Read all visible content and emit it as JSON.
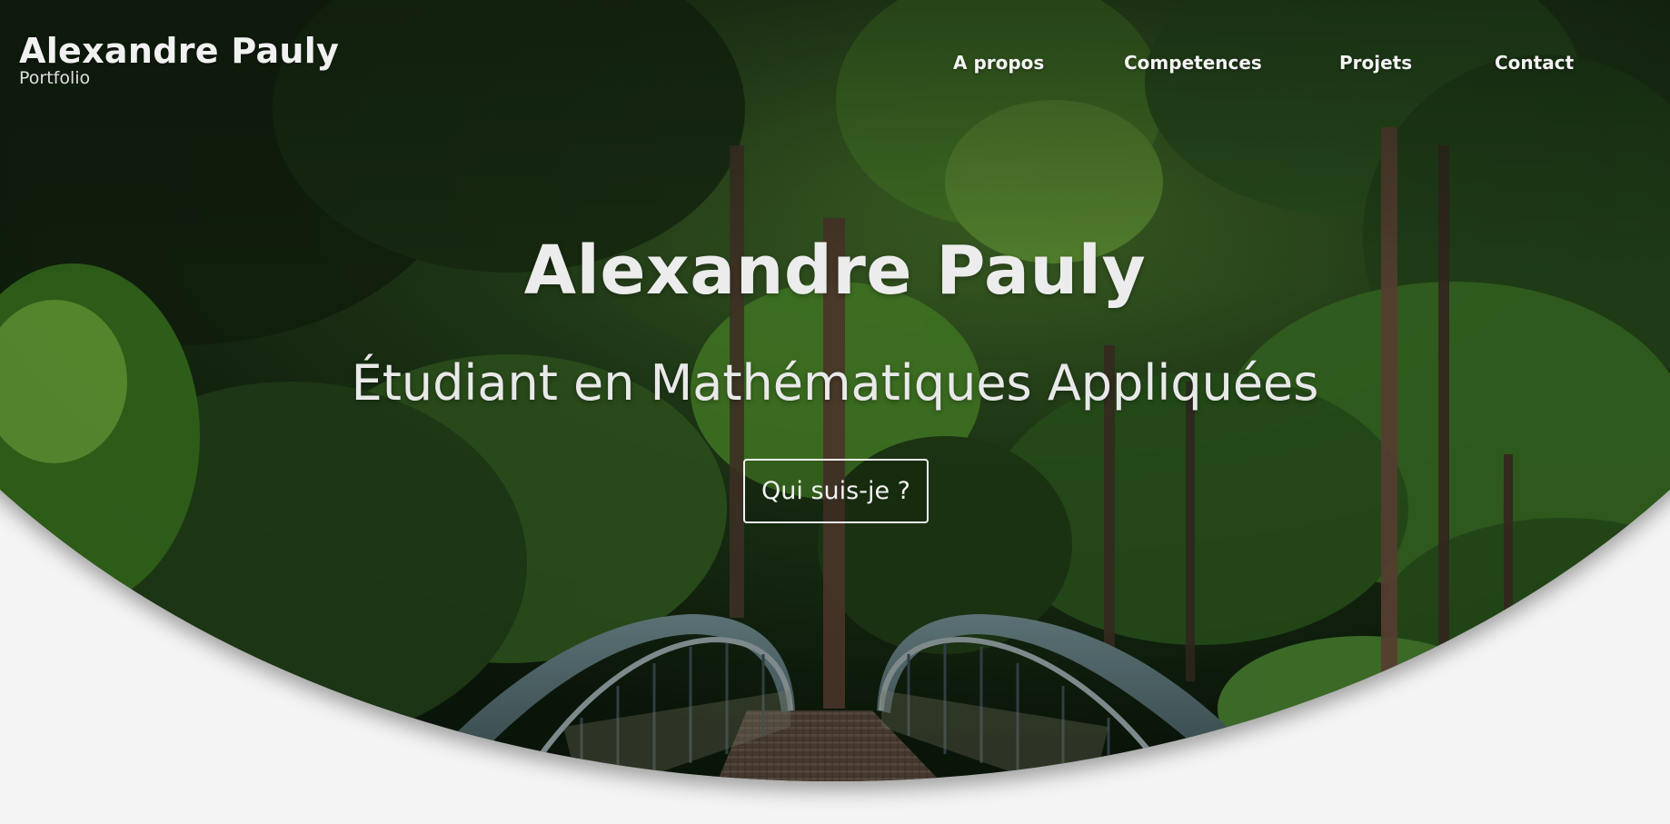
{
  "header": {
    "brand_name": "Alexandre Pauly",
    "brand_subtitle": "Portfolio"
  },
  "nav": {
    "items": [
      {
        "label": "A propos"
      },
      {
        "label": "Competences"
      },
      {
        "label": "Projets"
      },
      {
        "label": "Contact"
      }
    ]
  },
  "hero": {
    "title": "Alexandre Pauly",
    "subtitle": "Étudiant en Mathématiques Appliquées",
    "cta_label": "Qui suis-je ?",
    "background_description_icon": "forest-bridge-image"
  },
  "colors": {
    "page_background": "#f4f4f4",
    "hero_text": "#ececec",
    "forest_dark": "#0d1a0c",
    "forest_light": "#7fb34a",
    "bridge_steel": "#5d7478"
  }
}
